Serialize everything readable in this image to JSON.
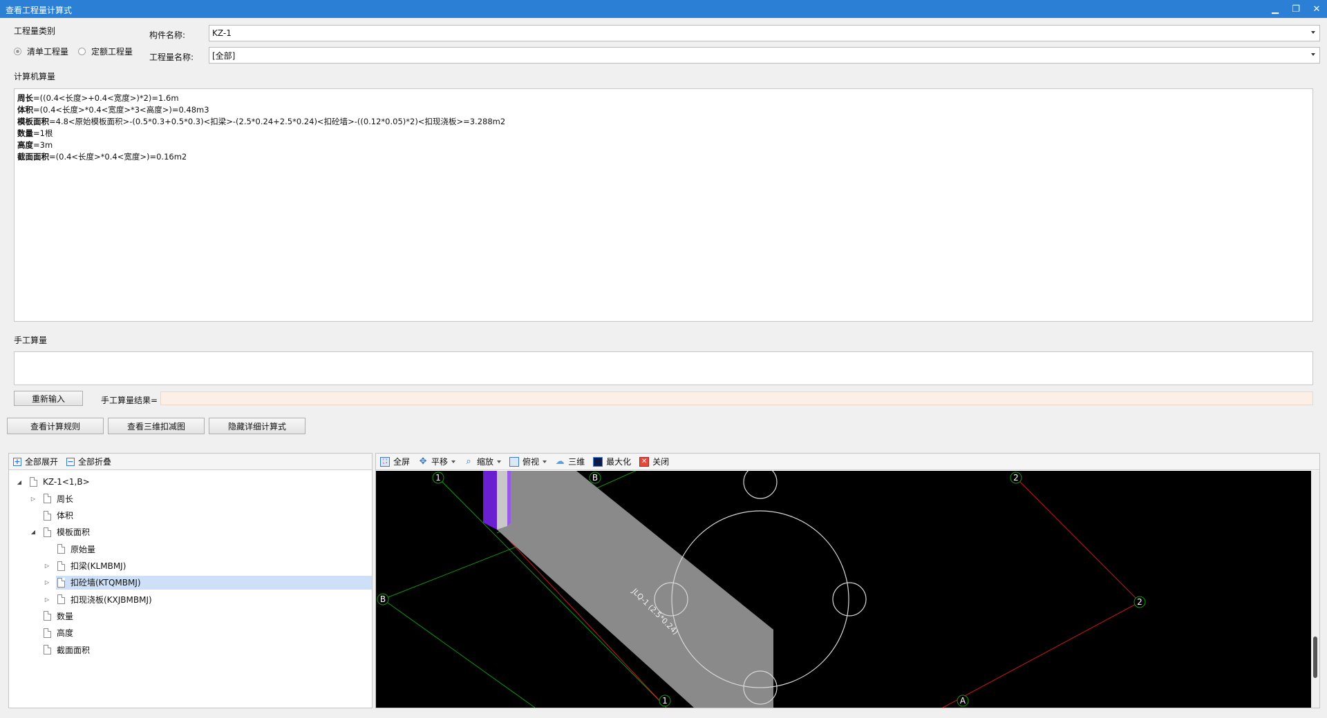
{
  "window": {
    "title": "查看工程量计算式",
    "minimize": "▁",
    "restore": "❐",
    "close": "✕"
  },
  "category": {
    "title": "工程量类别",
    "options": [
      {
        "label": "清单工程量",
        "checked": true
      },
      {
        "label": "定额工程量",
        "checked": false
      }
    ]
  },
  "component": {
    "label": "构件名称:",
    "value": "KZ-1"
  },
  "quantity_name": {
    "label": "工程量名称:",
    "value": "[全部]"
  },
  "computer_calc": {
    "title": "计算机算量",
    "lines": [
      {
        "name": "周长",
        "expr": "=((0.4<长度>+0.4<宽度>)*2)=1.6m"
      },
      {
        "name": "体积",
        "expr": "=(0.4<长度>*0.4<宽度>*3<高度>)=0.48m3"
      },
      {
        "name": "模板面积",
        "expr": "=4.8<原始模板面积>-(0.5*0.3+0.5*0.3)<扣梁>-(2.5*0.24+2.5*0.24)<扣砼墙>-((0.12*0.05)*2)<扣现浇板>=3.288m2"
      },
      {
        "name": "数量",
        "expr": "=1根"
      },
      {
        "name": "高度",
        "expr": "=3m"
      },
      {
        "name": "截面面积",
        "expr": "=(0.4<长度>*0.4<宽度>)=0.16m2"
      }
    ]
  },
  "manual_calc": {
    "title": "手工算量",
    "reinput_label": "重新输入",
    "result_label": "手工算量结果=",
    "result_value": ""
  },
  "actions": {
    "view_rules": "查看计算规则",
    "view_3d": "查看三维扣减图",
    "hide_detail": "隐藏详细计算式"
  },
  "tree_toolbar": {
    "expand_all": "全部展开",
    "collapse_all": "全部折叠"
  },
  "tree": [
    {
      "label": "KZ-1<1,B>",
      "level": 0,
      "twisty": "◢",
      "selected": false
    },
    {
      "label": "周长",
      "level": 1,
      "twisty": "▷",
      "selected": false
    },
    {
      "label": "体积",
      "level": 1,
      "twisty": "",
      "selected": false
    },
    {
      "label": "模板面积",
      "level": 1,
      "twisty": "◢",
      "selected": false
    },
    {
      "label": "原始量",
      "level": 2,
      "twisty": "",
      "selected": false
    },
    {
      "label": "扣梁(KLMBMJ)",
      "level": 2,
      "twisty": "▷",
      "selected": false
    },
    {
      "label": "扣砼墙(KTQMBMJ)",
      "level": 2,
      "twisty": "▷",
      "selected": true
    },
    {
      "label": "扣现浇板(KXJBMBMJ)",
      "level": 2,
      "twisty": "▷",
      "selected": false
    },
    {
      "label": "数量",
      "level": 1,
      "twisty": "",
      "selected": false
    },
    {
      "label": "高度",
      "level": 1,
      "twisty": "",
      "selected": false
    },
    {
      "label": "截面面积",
      "level": 1,
      "twisty": "",
      "selected": false
    }
  ],
  "view_toolbar": {
    "fullscreen": "全屏",
    "pan": "平移",
    "zoom": "缩放",
    "top_view": "俯视",
    "three_d": "三维",
    "maximize": "最大化",
    "close": "关闭"
  },
  "viewport": {
    "wall_label": "JLQ-1 (2.5*0.24)",
    "axis_labels": {
      "a1_top": "1",
      "b_top": "B",
      "a2_top": "2",
      "b_left": "B",
      "a1_bottom": "1",
      "a_bottom": "A",
      "a2_right": "2"
    }
  },
  "colors": {
    "titlebar": "#2b7fd4",
    "selection": "#cde0f7",
    "wall": "#8a8a8a",
    "column": "#6a1fd0",
    "grid_green": "#0e9a0e",
    "grid_red": "#d01818"
  }
}
